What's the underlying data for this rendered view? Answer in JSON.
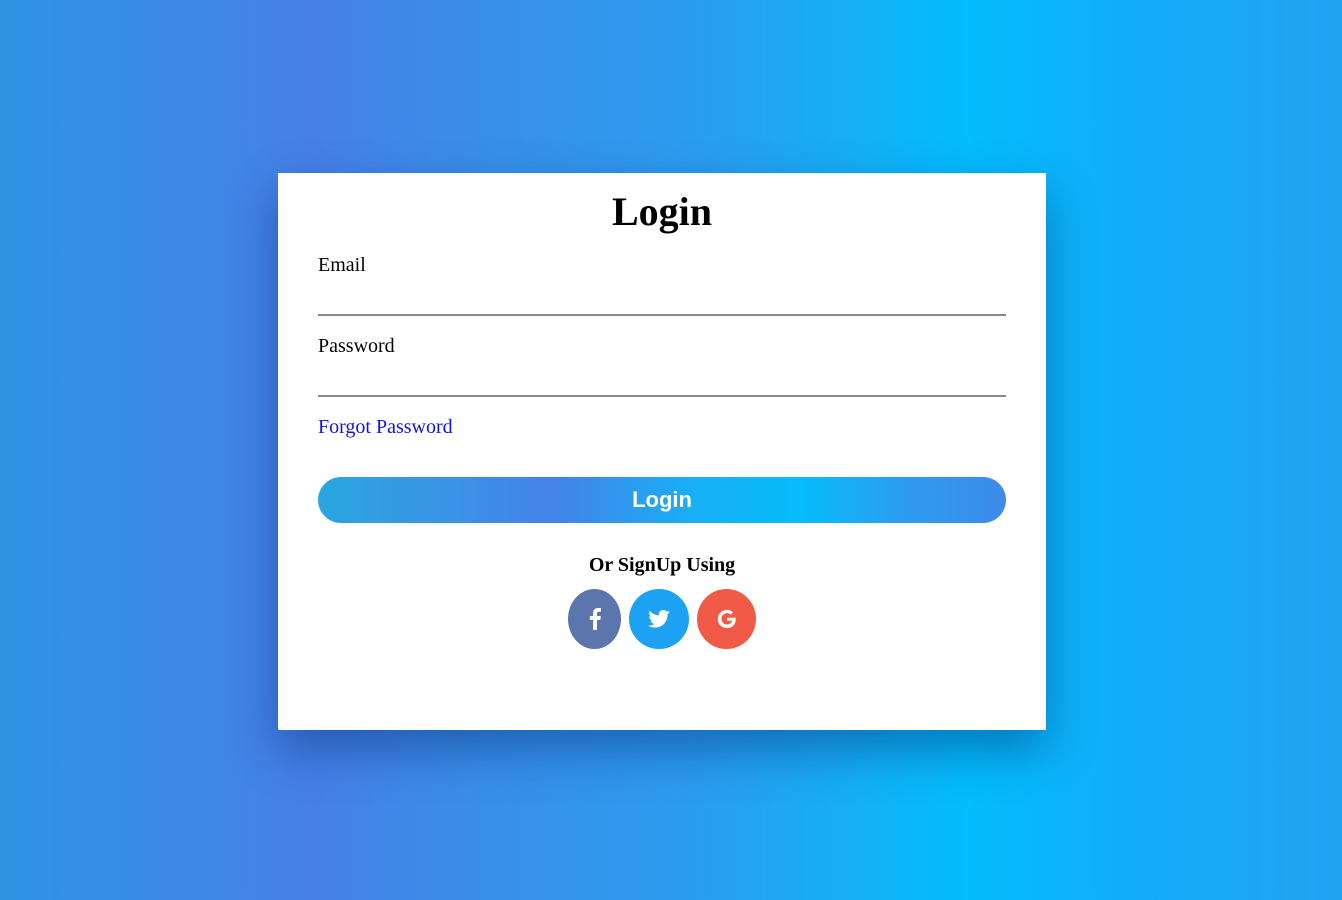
{
  "form": {
    "title": "Login",
    "email_label": "Email",
    "email_value": "",
    "password_label": "Password",
    "password_value": "",
    "forgot_link": "Forgot Password",
    "login_button": "Login",
    "signup_text": "Or SignUp Using"
  },
  "social": [
    {
      "icon": "facebook-icon",
      "color": "#5b75ad"
    },
    {
      "icon": "twitter-icon",
      "color": "#1da1f2"
    },
    {
      "icon": "google-icon",
      "color": "#f25a48"
    }
  ],
  "colors": {
    "link": "#1212e8",
    "gradient_blue": "#4680e8",
    "gradient_cyan": "#03bdfd"
  }
}
